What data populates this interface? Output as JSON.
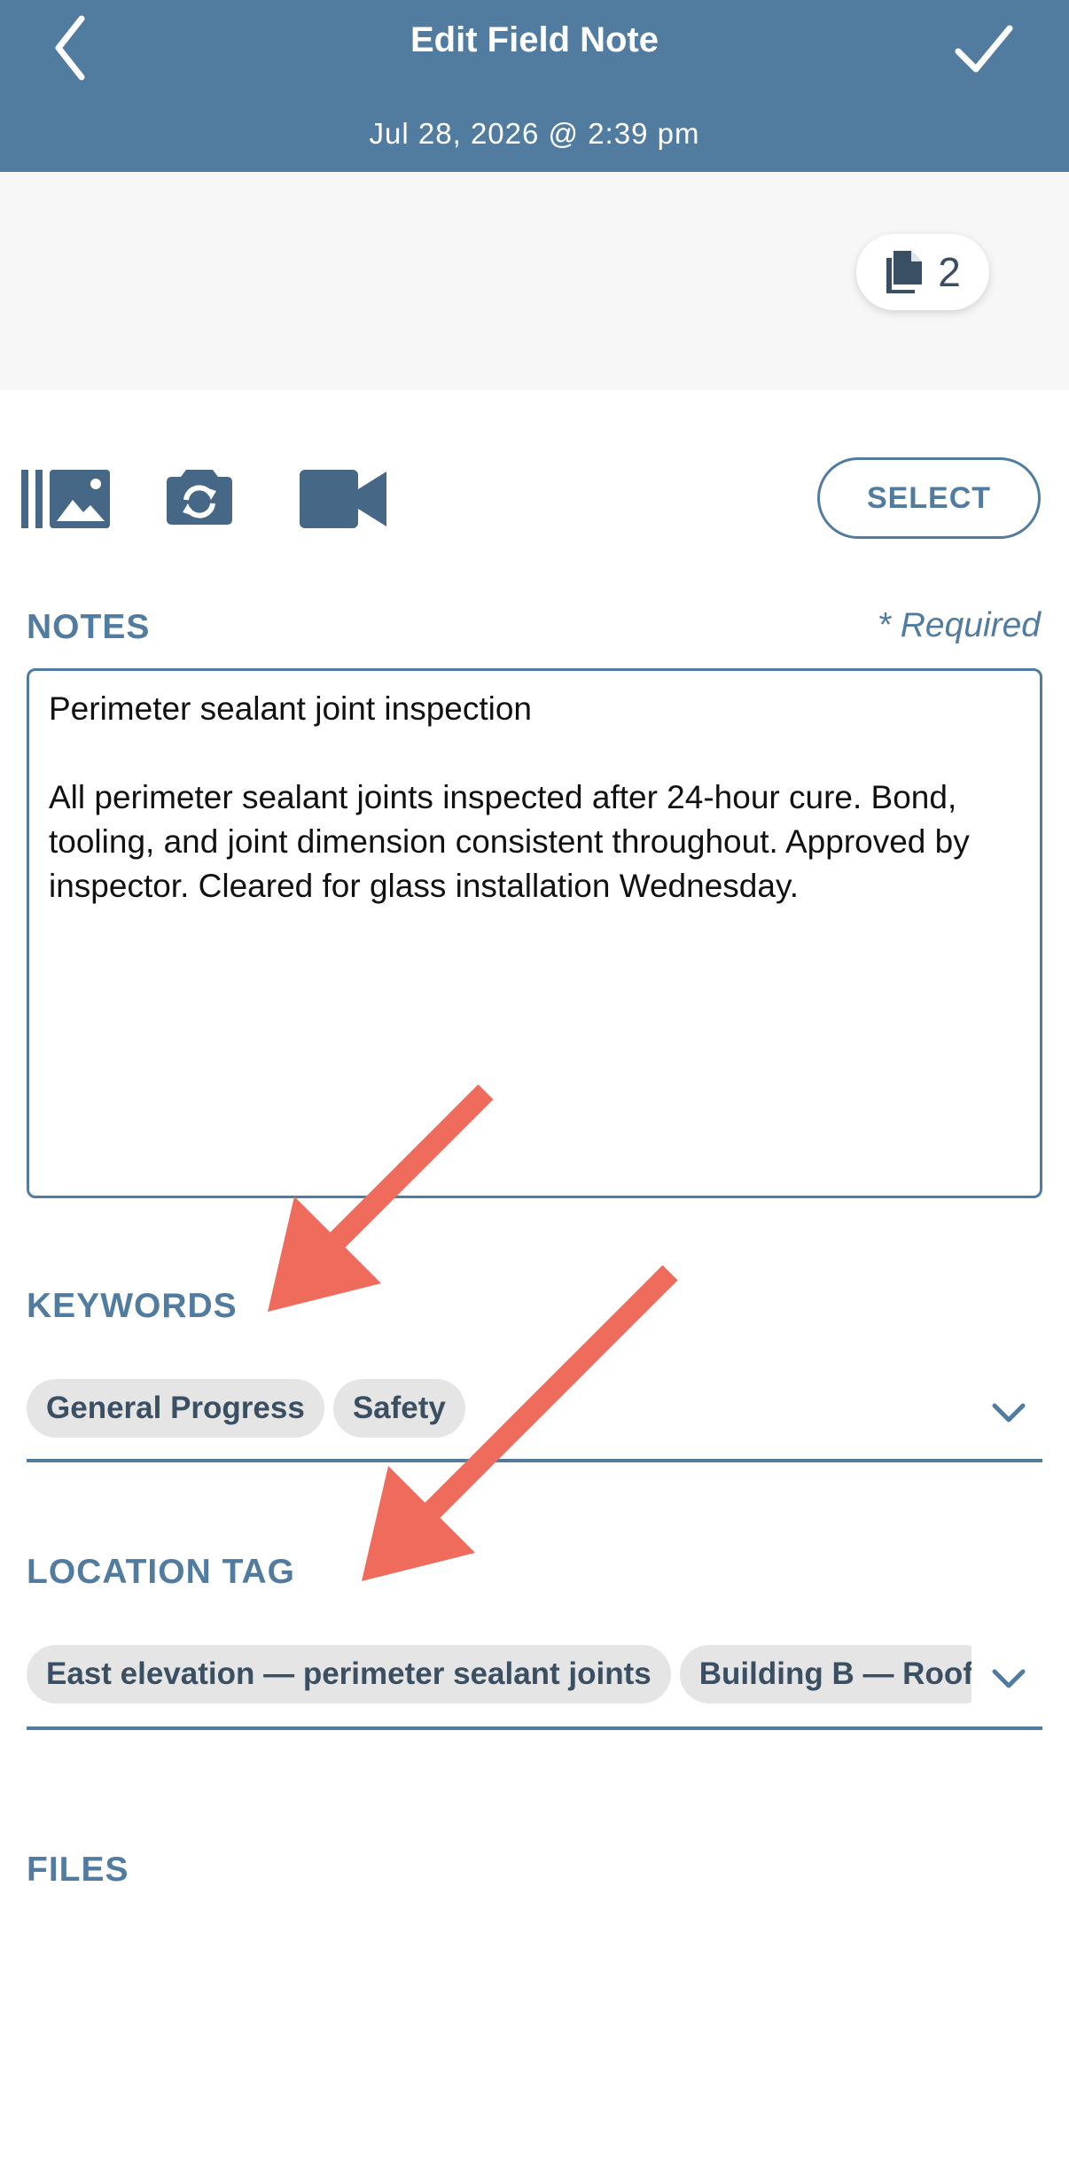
{
  "header": {
    "title": "Edit Field Note",
    "date": "Jul 28, 2026 @ 2:39 pm"
  },
  "attachments": {
    "count": "2"
  },
  "media": {
    "select_label": "SELECT"
  },
  "notes": {
    "label": "NOTES",
    "required": "* Required",
    "title_line": "Perimeter sealant joint inspection",
    "body": "All perimeter sealant joints inspected after 24-hour cure. Bond, tooling, and joint dimension consistent throughout. Approved by inspector. Cleared for glass installation Wednesday."
  },
  "keywords": {
    "label": "KEYWORDS",
    "chips": [
      "General Progress",
      "Safety"
    ]
  },
  "location": {
    "label": "LOCATION TAG",
    "chips": [
      "East elevation — perimeter sealant joints",
      "Building B — Roof"
    ]
  },
  "files": {
    "label": "FILES"
  },
  "colors": {
    "header": "#517ca0",
    "annotation_arrow": "#ef6b5b"
  }
}
